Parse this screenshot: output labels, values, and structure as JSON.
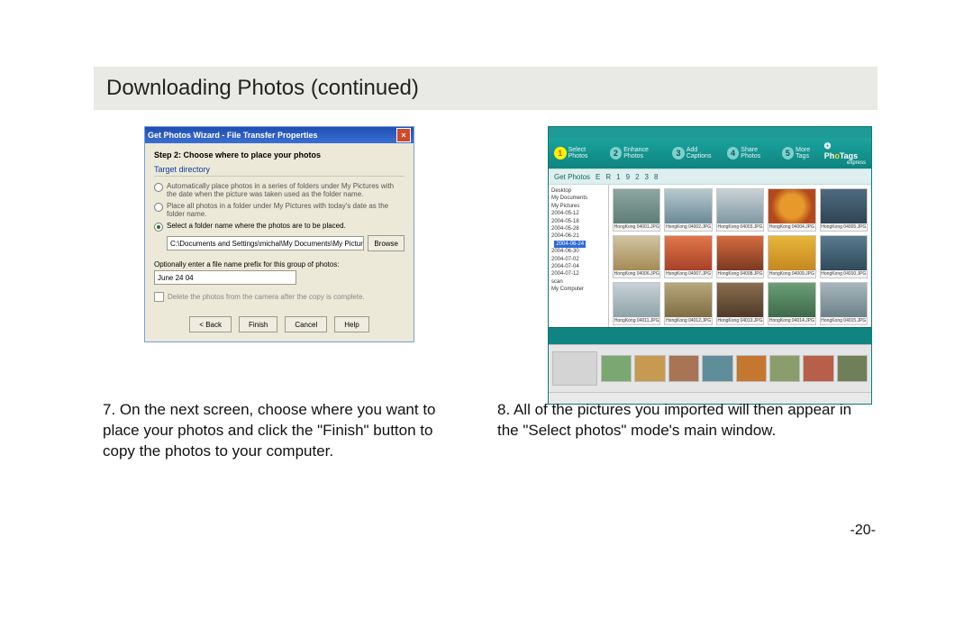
{
  "header": {
    "title": "Downloading Photos (continued)"
  },
  "page_number": "-20-",
  "captions": {
    "left": "7. On the next screen, choose where you want to place your photos and click the \"Finish\" button to copy the photos to your computer.",
    "right": "8. All of the pictures you imported will then appear in the \"Select photos\" mode's main window."
  },
  "dialog": {
    "title": "Get Photos Wizard - File Transfer Properties",
    "step": "Step 2: Choose where to place your photos",
    "legend": "Target directory",
    "option1": "Automatically place photos in a series of folders under My Pictures with the date when the picture was taken used as the folder name.",
    "option2": "Place all photos in a folder under My Pictures with today's date as the folder name.",
    "option3": "Select a folder name where the photos are to be placed.",
    "path": "C:\\Documents and Settings\\michal\\My Documents\\My Pictures\\scan",
    "browse": "Browse",
    "prefix_label": "Optionally enter a file name prefix for this group of photos:",
    "prefix_value": "June 24 04",
    "delete_label": "Delete the photos from the camera after the copy is complete.",
    "buttons": {
      "back": "< Back",
      "finish": "Finish",
      "cancel": "Cancel",
      "help": "Help"
    }
  },
  "app": {
    "brand": "PhoTags",
    "brand_suffix": "express",
    "steps": [
      {
        "n": "1",
        "label": "Select Photos"
      },
      {
        "n": "2",
        "label": "Enhance Photos"
      },
      {
        "n": "3",
        "label": "Add Captions"
      },
      {
        "n": "4",
        "label": "Share Photos"
      },
      {
        "n": "5",
        "label": "More Tags"
      }
    ],
    "toolbar": [
      "Get Photos",
      "E",
      "R",
      "1",
      "9",
      "2",
      "3",
      "8"
    ],
    "tree": [
      "Desktop",
      "My Documents",
      " My Pictures",
      "  2004-05-12",
      "  2004-05-18",
      "  2004-05-28",
      "  2004-06-21",
      "  2004-06-24",
      "  2004-06-30",
      "  2004-07-02",
      "  2004-07-04",
      "  2004-07-12",
      "  scan",
      "My Computer"
    ],
    "tree_selected": "  2004-06-24",
    "thumbs": [
      {
        "label": "HongKong 04001.JPG",
        "bg": "linear-gradient(#8da6a2,#5f7d77)"
      },
      {
        "label": "HongKong 04002.JPG",
        "bg": "linear-gradient(#b7c9cf,#6b8996)"
      },
      {
        "label": "HongKong 04003.JPG",
        "bg": "linear-gradient(#c9d2d6,#7f98a2)"
      },
      {
        "label": "HongKong 04004.JPG",
        "bg": "radial-gradient(circle,#e79a2b 40%,#b34a1c 70%)"
      },
      {
        "label": "HongKong 04005.JPG",
        "bg": "linear-gradient(#4f6a7f,#2f4555)"
      },
      {
        "label": "HongKong 04006.JPG",
        "bg": "linear-gradient(#d2c3a2,#a58b55)"
      },
      {
        "label": "HongKong 04007.JPG",
        "bg": "linear-gradient(#e0774a,#a8412a)"
      },
      {
        "label": "HongKong 04008.JPG",
        "bg": "linear-gradient(#d66b3f,#7a3a22)"
      },
      {
        "label": "HongKong 04009.JPG",
        "bg": "linear-gradient(#e7b63a,#c5881f)"
      },
      {
        "label": "HongKong 04010.JPG",
        "bg": "linear-gradient(#5a7a8f,#2f4a5a)"
      },
      {
        "label": "HongKong 04011.JPG",
        "bg": "linear-gradient(#c7d2d6,#8fa2aa)"
      },
      {
        "label": "HongKong 04012.JPG",
        "bg": "linear-gradient(#b8a77c,#7f6d44)"
      },
      {
        "label": "HongKong 04013.JPG",
        "bg": "linear-gradient(#8a6d4f,#4f3a28)"
      },
      {
        "label": "HongKong 04014.JPG",
        "bg": "linear-gradient(#6a9e78,#3f6a4a)"
      },
      {
        "label": "HongKong 04015.JPG",
        "bg": "linear-gradient(#a7b6bd,#6d8189)"
      }
    ],
    "tray_colors": [
      "#7ba772",
      "#c79a52",
      "#a77455",
      "#5f8e9a",
      "#c4772f",
      "#8a9e6b",
      "#b85f4a",
      "#6f7f5a"
    ]
  }
}
